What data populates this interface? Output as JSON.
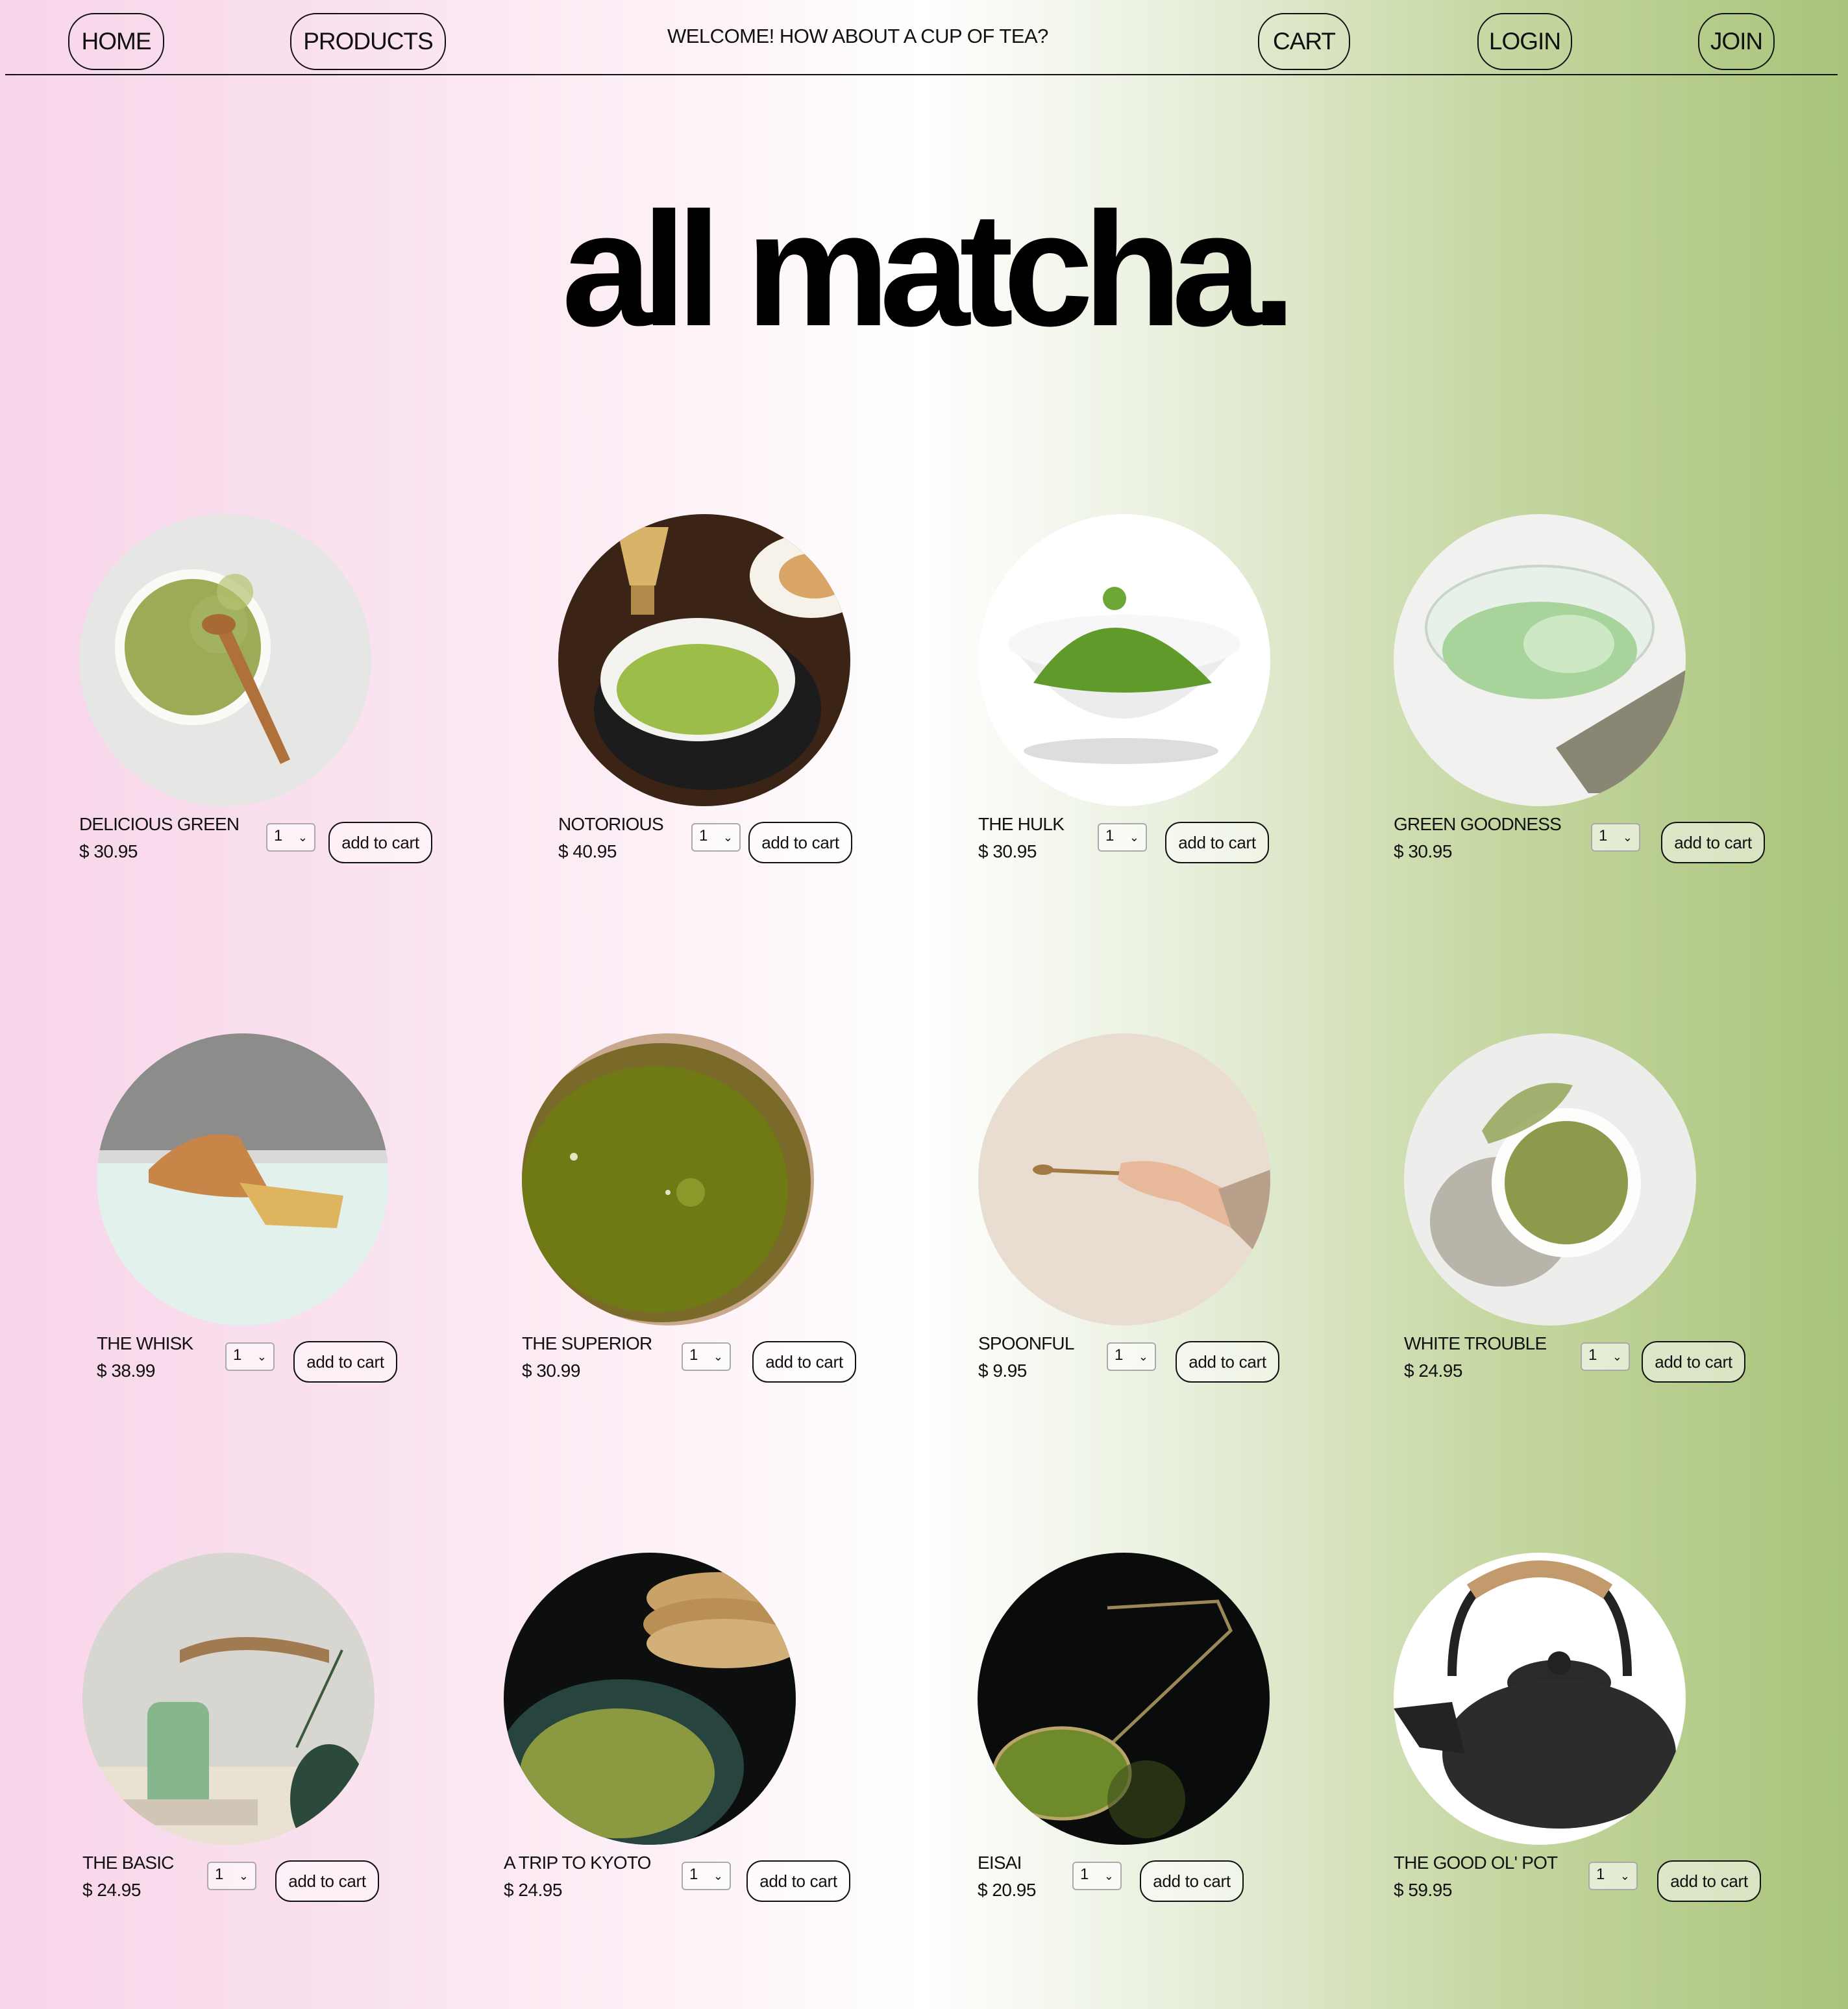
{
  "nav": {
    "home": "HOME",
    "products": "PRODUCTS",
    "welcome": "WELCOME! HOW ABOUT A CUP OF TEA?",
    "cart": "CART",
    "login": "LOGIN",
    "join": "JOIN"
  },
  "brand": "all matcha.",
  "cart_label": "add to cart",
  "products": [
    {
      "name": "DELICIOUS GREEN",
      "price": "$ 30.95",
      "qty": "1",
      "image": "matcha-powder-bowl-spoon"
    },
    {
      "name": "NOTORIOUS",
      "price": "$ 40.95",
      "qty": "1",
      "image": "matcha-cup-whisk"
    },
    {
      "name": "THE HULK",
      "price": "$ 30.95",
      "qty": "1",
      "image": "matcha-powder-white-bowl"
    },
    {
      "name": "GREEN GOODNESS",
      "price": "$ 30.95",
      "qty": "1",
      "image": "glass-matcha-tea"
    },
    {
      "name": "THE WHISK",
      "price": "$ 38.99",
      "qty": "1",
      "image": "bamboo-whisk"
    },
    {
      "name": "THE SUPERIOR",
      "price": "$ 30.99",
      "qty": "1",
      "image": "matcha-tea-surface"
    },
    {
      "name": "SPOONFUL",
      "price": "$ 9.95",
      "qty": "1",
      "image": "hand-bamboo-spoon"
    },
    {
      "name": "WHITE TROUBLE",
      "price": "$ 24.95",
      "qty": "1",
      "image": "matcha-powder-small-bowl"
    },
    {
      "name": "THE BASIC",
      "price": "$ 24.95",
      "qty": "1",
      "image": "iced-matcha-latte"
    },
    {
      "name": "A TRIP TO KYOTO",
      "price": "$ 24.95",
      "qty": "1",
      "image": "matcha-plate-pancakes"
    },
    {
      "name": "EISAI",
      "price": "$ 20.95",
      "qty": "1",
      "image": "matcha-sieve"
    },
    {
      "name": "THE GOOD OL' POT",
      "price": "$ 59.95",
      "qty": "1",
      "image": "cast-iron-teapot"
    }
  ]
}
